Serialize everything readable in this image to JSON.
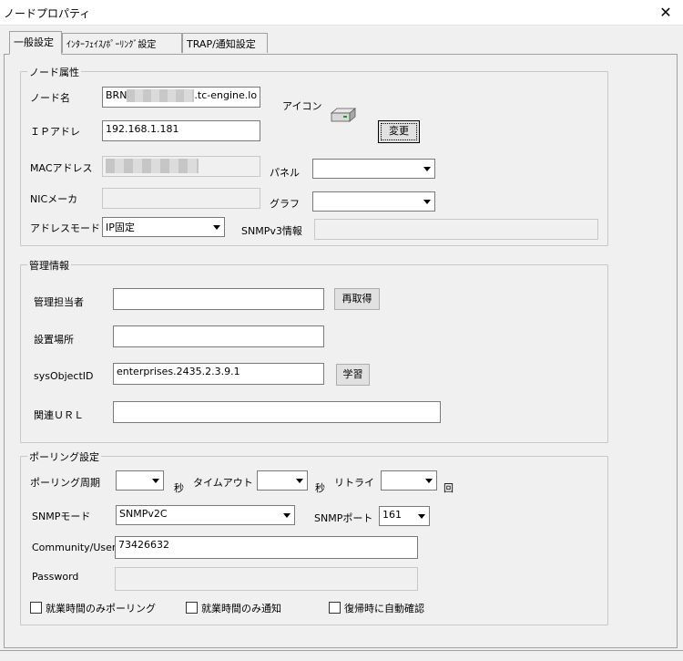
{
  "window": {
    "title": "ノードプロパティ",
    "close_glyph": "✕"
  },
  "tabs": [
    {
      "label": "一般設定",
      "active": true
    },
    {
      "label": "ｲﾝﾀｰﾌｪｲｽ/ﾎﾟｰﾘﾝｸﾞ設定",
      "active": false
    },
    {
      "label": "TRAP/通知設定",
      "active": false
    }
  ],
  "node_attributes": {
    "legend": "ノード属性",
    "name_label": "ノード名",
    "name_prefix": "BRN",
    "name_suffix": ".tc-engine.lo",
    "ip_label": "ＩＰアドレ",
    "ip_value": "192.168.1.181",
    "mac_label": "MACアドレス",
    "mac_value": "",
    "nic_label": "NICメーカ",
    "nic_value": "",
    "addr_mode_label": "アドレスモード",
    "addr_mode_value": "IP固定",
    "icon_label": "アイコン",
    "icon_name": "network-device-icon",
    "change_button": "変更",
    "panel_label": "パネル",
    "panel_value": "",
    "graph_label": "グラフ",
    "graph_value": "",
    "snmpv3_label": "SNMPv3情報",
    "snmpv3_value": ""
  },
  "management": {
    "legend": "管理情報",
    "manager_label": "管理担当者",
    "manager_value": "",
    "refetch_button": "再取得",
    "location_label": "設置場所",
    "location_value": "",
    "sysobjectid_label": "sysObjectID",
    "sysobjectid_value": "enterprises.2435.2.3.9.1",
    "learn_button": "学習",
    "url_label": "関連ＵＲＬ",
    "url_value": ""
  },
  "polling": {
    "legend": "ポーリング設定",
    "interval_label": "ポーリング周期",
    "interval_value": "",
    "sec_unit_1": "秒",
    "timeout_label": "タイムアウト",
    "timeout_value": "",
    "sec_unit_2": "秒",
    "retry_label": "リトライ",
    "retry_value": "",
    "times_unit": "回",
    "snmp_mode_label": "SNMPモード",
    "snmp_mode_value": "SNMPv2C",
    "snmp_port_label": "SNMPポート",
    "snmp_port_value": "161",
    "community_label": "Community/User",
    "community_value": "73426632",
    "password_label": "Password",
    "password_value": "",
    "cb_poll_business_hours": {
      "label": "就業時間のみポーリング",
      "checked": false
    },
    "cb_notify_business_hours": {
      "label": "就業時間のみ通知",
      "checked": false
    },
    "cb_auto_confirm_recovery": {
      "label": "復帰時に自動確認",
      "checked": false
    }
  }
}
